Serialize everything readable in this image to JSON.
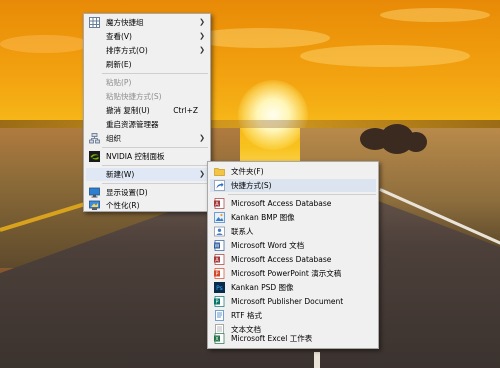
{
  "main_menu": {
    "items": [
      {
        "label": "魔方快捷组",
        "shortcut": "",
        "has_submenu": true,
        "disabled": false,
        "icon": "grid-icon"
      },
      {
        "label": "查看(V)",
        "shortcut": "",
        "has_submenu": true,
        "disabled": false,
        "icon": ""
      },
      {
        "label": "排序方式(O)",
        "shortcut": "",
        "has_submenu": true,
        "disabled": false,
        "icon": ""
      },
      {
        "label": "刷新(E)",
        "shortcut": "",
        "has_submenu": false,
        "disabled": false,
        "icon": ""
      },
      {
        "label": "粘贴(P)",
        "shortcut": "",
        "has_submenu": false,
        "disabled": true,
        "icon": ""
      },
      {
        "label": "粘贴快捷方式(S)",
        "shortcut": "",
        "has_submenu": false,
        "disabled": true,
        "icon": ""
      },
      {
        "label": "撤消 复制(U)",
        "shortcut": "Ctrl+Z",
        "has_submenu": false,
        "disabled": false,
        "icon": ""
      },
      {
        "label": "重启资源管理器",
        "shortcut": "",
        "has_submenu": false,
        "disabled": false,
        "icon": ""
      },
      {
        "label": "组织",
        "shortcut": "",
        "has_submenu": true,
        "disabled": false,
        "icon": "org-icon"
      },
      {
        "label": "NVIDIA 控制面板",
        "shortcut": "",
        "has_submenu": false,
        "disabled": false,
        "icon": "nvidia-icon"
      },
      {
        "label": "新建(W)",
        "shortcut": "",
        "has_submenu": true,
        "disabled": false,
        "icon": ""
      },
      {
        "label": "显示设置(D)",
        "shortcut": "",
        "has_submenu": false,
        "disabled": false,
        "icon": "display-icon"
      },
      {
        "label": "个性化(R)",
        "shortcut": "",
        "has_submenu": false,
        "disabled": false,
        "icon": "personalize-icon"
      }
    ]
  },
  "new_submenu": {
    "items": [
      {
        "label": "文件夹(F)",
        "icon": "folder-icon"
      },
      {
        "label": "快捷方式(S)",
        "icon": "shortcut-icon"
      },
      {
        "label": "Microsoft Access Database",
        "icon": "access-icon"
      },
      {
        "label": "Kankan BMP 图像",
        "icon": "bmp-icon"
      },
      {
        "label": "联系人",
        "icon": "contact-icon"
      },
      {
        "label": "Microsoft Word 文档",
        "icon": "word-icon"
      },
      {
        "label": "Microsoft Access Database",
        "icon": "access-icon"
      },
      {
        "label": "Microsoft PowerPoint 演示文稿",
        "icon": "powerpoint-icon"
      },
      {
        "label": "Kankan PSD 图像",
        "icon": "psd-icon"
      },
      {
        "label": "Microsoft Publisher Document",
        "icon": "publisher-icon"
      },
      {
        "label": "RTF 格式",
        "icon": "rtf-icon"
      },
      {
        "label": "文本文档",
        "icon": "text-doc-icon"
      },
      {
        "label": "Microsoft Excel 工作表",
        "icon": "excel-icon"
      }
    ]
  },
  "colors": {
    "menu_bg": "#f0f0f0",
    "highlight": "#dfe8f4",
    "disabled_text": "#8d8d8d",
    "nvidia_green": "#76b900",
    "word_blue": "#2b579a",
    "excel_green": "#217346",
    "powerpoint_orange": "#d24726",
    "access_red": "#a4373a",
    "folder_yellow": "#f4c542"
  }
}
